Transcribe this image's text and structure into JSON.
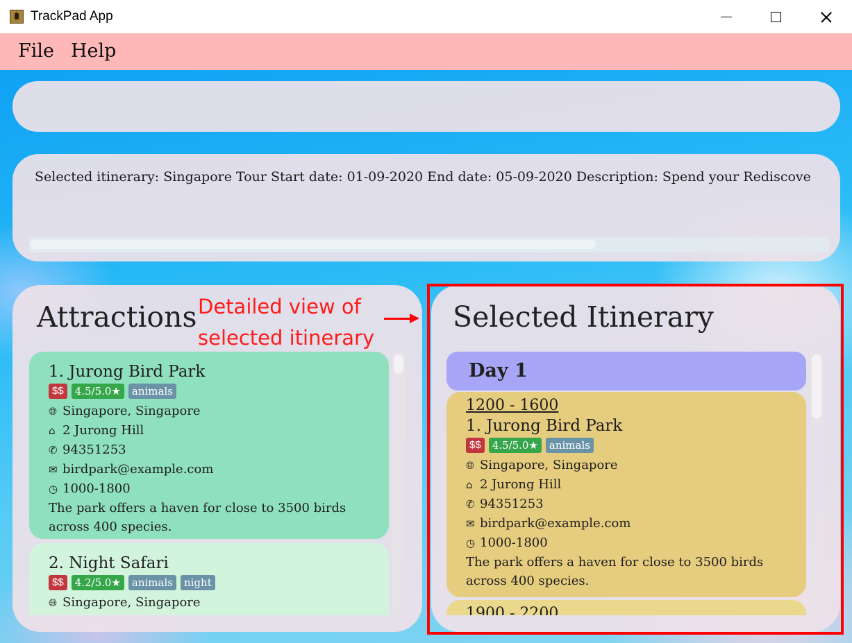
{
  "window": {
    "title": "TrackPad App"
  },
  "menu": {
    "file": "File",
    "help": "Help"
  },
  "command_box": {
    "value": ""
  },
  "result": {
    "text": "Selected itinerary: Singapore Tour Start date: 01-09-2020 End date: 05-09-2020 Description: Spend your Rediscove"
  },
  "attractions": {
    "title": "Attractions",
    "items": [
      {
        "name": "1.  Jurong Bird Park",
        "price": "$$",
        "rating": "4.5/5.0★",
        "tags": [
          "animals"
        ],
        "location": "Singapore, Singapore",
        "address": "2 Jurong Hill",
        "phone": "94351253",
        "email": "birdpark@example.com",
        "hours": "1000-1800",
        "description": "The park offers a haven for close to 3500 birds across 400 species."
      },
      {
        "name": "2.  Night Safari",
        "price": "$$",
        "rating": "4.2/5.0★",
        "tags": [
          "animals",
          "night"
        ],
        "location": "Singapore, Singapore"
      }
    ]
  },
  "itinerary": {
    "title": "Selected Itinerary",
    "day_label": "Day 1",
    "entries": [
      {
        "time": "1200 - 1600",
        "name": "1.  Jurong Bird Park",
        "price": "$$",
        "rating": "4.5/5.0★",
        "tags": [
          "animals"
        ],
        "location": "Singapore, Singapore",
        "address": "2 Jurong Hill",
        "phone": "94351253",
        "email": "birdpark@example.com",
        "hours": "1000-1800",
        "description": "The park offers a haven for close to 3500 birds across 400 species."
      },
      {
        "time": "1900 - 2200"
      }
    ]
  },
  "annotation": {
    "line1": "Detailed view of",
    "line2": "selected itinerary"
  },
  "icons": {
    "app": "trackpad-app-icon",
    "location": "globe-icon",
    "address": "home-icon",
    "phone": "phone-icon",
    "email": "mail-icon",
    "hours": "clock-icon"
  },
  "colors": {
    "menubar": "#ffb8b8",
    "highlight": "#ff0000",
    "attraction_card": "#8fe0be",
    "itinerary_card": "#e6cc7e",
    "day_header": "#a7a6f6"
  }
}
